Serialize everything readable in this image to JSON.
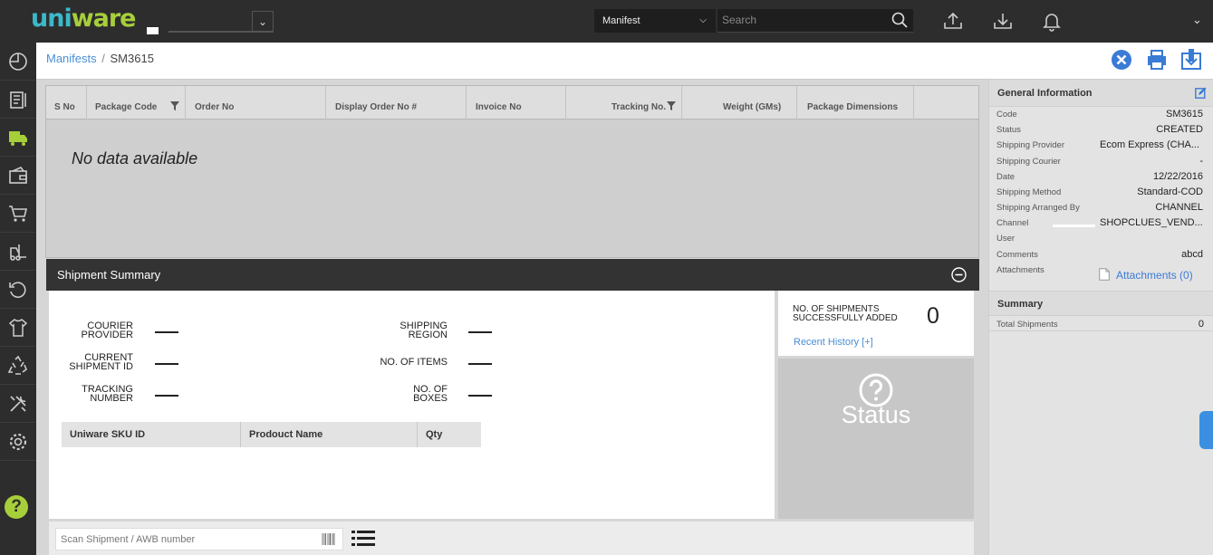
{
  "app": {
    "logo_text_a": "uni",
    "logo_text_b": "ware",
    "facility_value": "",
    "search_type": "Manifest",
    "search_placeholder": "Search"
  },
  "breadcrumb": {
    "parent": "Manifests",
    "separator": "/",
    "current": "SM3615"
  },
  "packages_table": {
    "columns": [
      "S No",
      "Package Code",
      "Order No",
      "Display Order No #",
      "Invoice No",
      "Tracking No.",
      "Weight (GMs)",
      "Package Dimensions"
    ],
    "empty_message": "No data available"
  },
  "shipment_summary": {
    "title": "Shipment Summary",
    "fields": {
      "courier_provider": {
        "label_1": "COURIER",
        "label_2": "PROVIDER"
      },
      "current_shipment_id": {
        "label_1": "CURRENT",
        "label_2": "SHIPMENT ID"
      },
      "tracking_number": {
        "label_1": "TRACKING",
        "label_2": "NUMBER"
      },
      "shipping_region": {
        "label_1": "SHIPPING",
        "label_2": "REGION"
      },
      "no_of_items": {
        "label_1": "NO. OF ITEMS"
      },
      "no_of_boxes": {
        "label_1": "NO. OF",
        "label_2": "BOXES"
      }
    },
    "sku_columns": [
      "Uniware SKU ID",
      "Prodouct Name",
      "Qty"
    ],
    "count_label_1": "NO. OF SHIPMENTS",
    "count_label_2": "SUCCESSFULLY ADDED",
    "count_value": "0",
    "recent_history": "Recent History [+]",
    "status_label": "Status",
    "scan_placeholder": "Scan Shipment / AWB number"
  },
  "general_information": {
    "title": "General Information",
    "rows": [
      {
        "key": "Code",
        "value": "SM3615"
      },
      {
        "key": "Status",
        "value": "CREATED"
      },
      {
        "key": "Shipping Provider",
        "value": "Ecom Express (CHA..."
      },
      {
        "key": "Shipping Courier",
        "value": "-"
      },
      {
        "key": "Date",
        "value": "12/22/2016"
      },
      {
        "key": "Shipping Method",
        "value": "Standard-COD"
      },
      {
        "key": "Shipping Arranged By",
        "value": "CHANNEL"
      },
      {
        "key": "Channel",
        "value": "SHOPCLUES_VEND..."
      },
      {
        "key": "User",
        "value": ""
      },
      {
        "key": "Comments",
        "value": "abcd"
      },
      {
        "key": "Attachments",
        "value": "Attachments (0)"
      }
    ]
  },
  "summary": {
    "title": "Summary",
    "total_key": "Total Shipments",
    "total_value": "0"
  },
  "colors": {
    "dark_bar": "#2d2d2d",
    "link_blue": "#4a8fd6",
    "brand_teal": "#3db8c9",
    "brand_green": "#a7cf3a",
    "close_blue": "#3a7bd5"
  },
  "icons": {
    "top": [
      "upload-icon",
      "download-icon",
      "bell-icon"
    ],
    "sidebar": [
      "dashboard-icon",
      "orders-icon",
      "shipping-icon",
      "payments-icon",
      "cart-icon",
      "forklift-icon",
      "returns-icon",
      "products-icon",
      "recycle-icon",
      "tools-icon",
      "settings-icon",
      "help-icon"
    ]
  }
}
